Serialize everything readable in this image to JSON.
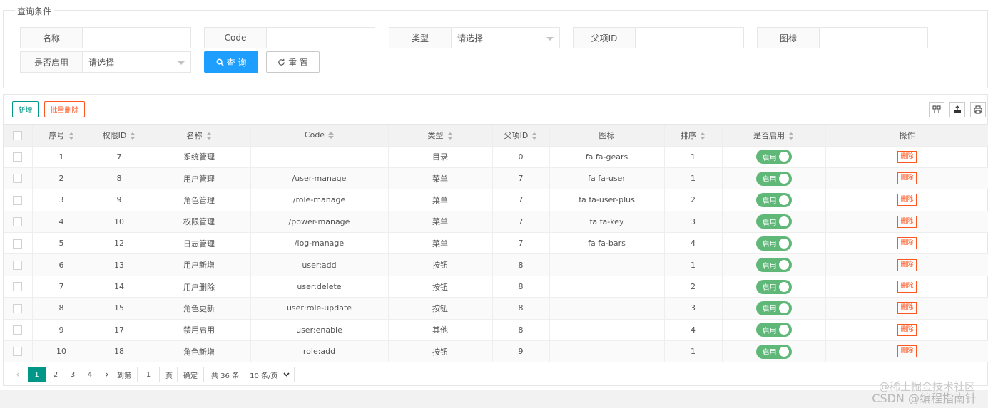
{
  "query": {
    "legend": "查询条件",
    "fields": [
      {
        "label": "名称",
        "value": ""
      },
      {
        "label": "Code",
        "value": ""
      },
      {
        "label": "类型",
        "value": "请选择"
      },
      {
        "label": "父项ID",
        "value": ""
      },
      {
        "label": "图标",
        "value": ""
      },
      {
        "label": "是否启用",
        "value": "请选择"
      }
    ],
    "search_label": "查 询",
    "reset_label": "重 置"
  },
  "toolbar": {
    "add_label": "新增",
    "batch_delete_label": "批量删除",
    "icons": [
      "columns-filter-icon",
      "export-icon",
      "print-icon"
    ]
  },
  "table": {
    "headers": [
      "序号",
      "权限ID",
      "名称",
      "Code",
      "类型",
      "父项ID",
      "图标",
      "排序",
      "是否启用",
      "操作"
    ],
    "rows": [
      {
        "no": "1",
        "id": "7",
        "name": "系统管理",
        "code": "",
        "type": "目录",
        "pid": "0",
        "icon": "fa fa-gears",
        "sort": "1",
        "enabled": "启用",
        "action": "删除"
      },
      {
        "no": "2",
        "id": "8",
        "name": "用户管理",
        "code": "/user-manage",
        "type": "菜单",
        "pid": "7",
        "icon": "fa fa-user",
        "sort": "1",
        "enabled": "启用",
        "action": "删除"
      },
      {
        "no": "3",
        "id": "9",
        "name": "角色管理",
        "code": "/role-manage",
        "type": "菜单",
        "pid": "7",
        "icon": "fa fa-user-plus",
        "sort": "2",
        "enabled": "启用",
        "action": "删除"
      },
      {
        "no": "4",
        "id": "10",
        "name": "权限管理",
        "code": "/power-manage",
        "type": "菜单",
        "pid": "7",
        "icon": "fa fa-key",
        "sort": "3",
        "enabled": "启用",
        "action": "删除"
      },
      {
        "no": "5",
        "id": "12",
        "name": "日志管理",
        "code": "/log-manage",
        "type": "菜单",
        "pid": "7",
        "icon": "fa fa-bars",
        "sort": "4",
        "enabled": "启用",
        "action": "删除"
      },
      {
        "no": "6",
        "id": "13",
        "name": "用户新增",
        "code": "user:add",
        "type": "按钮",
        "pid": "8",
        "icon": "",
        "sort": "1",
        "enabled": "启用",
        "action": "删除"
      },
      {
        "no": "7",
        "id": "14",
        "name": "用户删除",
        "code": "user:delete",
        "type": "按钮",
        "pid": "8",
        "icon": "",
        "sort": "2",
        "enabled": "启用",
        "action": "删除"
      },
      {
        "no": "8",
        "id": "15",
        "name": "角色更新",
        "code": "user:role-update",
        "type": "按钮",
        "pid": "8",
        "icon": "",
        "sort": "3",
        "enabled": "启用",
        "action": "删除"
      },
      {
        "no": "9",
        "id": "17",
        "name": "禁用启用",
        "code": "user:enable",
        "type": "其他",
        "pid": "8",
        "icon": "",
        "sort": "4",
        "enabled": "启用",
        "action": "删除"
      },
      {
        "no": "10",
        "id": "18",
        "name": "角色新增",
        "code": "role:add",
        "type": "按钮",
        "pid": "9",
        "icon": "",
        "sort": "1",
        "enabled": "启用",
        "action": "删除"
      }
    ]
  },
  "pager": {
    "pages": [
      "1",
      "2",
      "3",
      "4"
    ],
    "current": "1",
    "goto_label": "到第",
    "goto_value": "1",
    "page_unit": "页",
    "confirm_label": "确定",
    "total_text": "共 36 条",
    "page_size": "10 条/页"
  },
  "watermark": "CSDN @编程指南针",
  "watermark2": "@稀土掘金技术社区",
  "colors": {
    "primary": "#1e9fff",
    "green": "#009688",
    "danger": "#ff5722",
    "switch_on": "#5fb878"
  }
}
